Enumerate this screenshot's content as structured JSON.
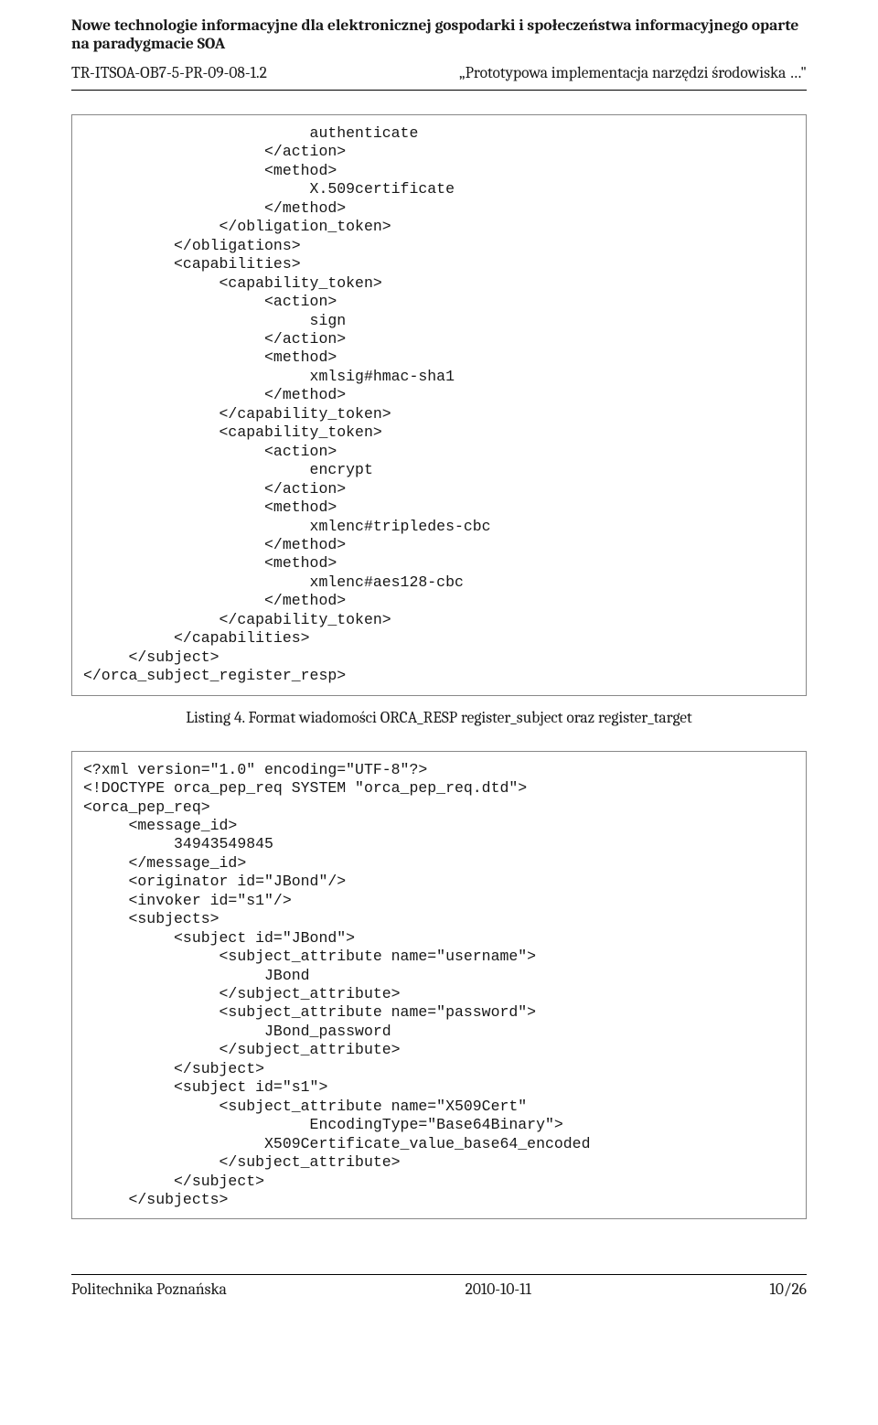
{
  "header": {
    "running_head": "Nowe technologie informacyjne dla elektronicznej gospodarki i społeczeństwa informacyjnego oparte na paradygmacie SOA",
    "doc_id": "TR-ITSOA-OB7-5-PR-09-08-1.2",
    "doc_title_right": "„Prototypowa implementacja narzędzi środowiska …\""
  },
  "codebox1": "                         authenticate\n                    </action>\n                    <method>\n                         X.509certificate\n                    </method>\n               </obligation_token>\n          </obligations>\n          <capabilities>\n               <capability_token>\n                    <action>\n                         sign\n                    </action>\n                    <method>\n                         xmlsig#hmac-sha1\n                    </method>\n               </capability_token>\n               <capability_token>\n                    <action>\n                         encrypt\n                    </action>\n                    <method>\n                         xmlenc#tripledes-cbc\n                    </method>\n                    <method>\n                         xmlenc#aes128-cbc\n                    </method>\n               </capability_token>\n          </capabilities>\n     </subject>\n</orca_subject_register_resp>",
  "caption1": "Listing 4. Format wiadomości ORCA_RESP register_subject oraz register_target",
  "codebox2": "<?xml version=\"1.0\" encoding=\"UTF-8\"?>\n<!DOCTYPE orca_pep_req SYSTEM \"orca_pep_req.dtd\">\n<orca_pep_req>\n     <message_id>\n          34943549845\n     </message_id>\n     <originator id=\"JBond\"/>\n     <invoker id=\"s1\"/>\n     <subjects>\n          <subject id=\"JBond\">\n               <subject_attribute name=\"username\">\n                    JBond\n               </subject_attribute>\n               <subject_attribute name=\"password\">\n                    JBond_password\n               </subject_attribute>\n          </subject>\n          <subject id=\"s1\">\n               <subject_attribute name=\"X509Cert\"\n                         EncodingType=\"Base64Binary\">\n                    X509Certificate_value_base64_encoded\n               </subject_attribute>\n          </subject>\n     </subjects>",
  "footer": {
    "left": "Politechnika Poznańska",
    "center": "2010-10-11",
    "right": "10/26"
  }
}
